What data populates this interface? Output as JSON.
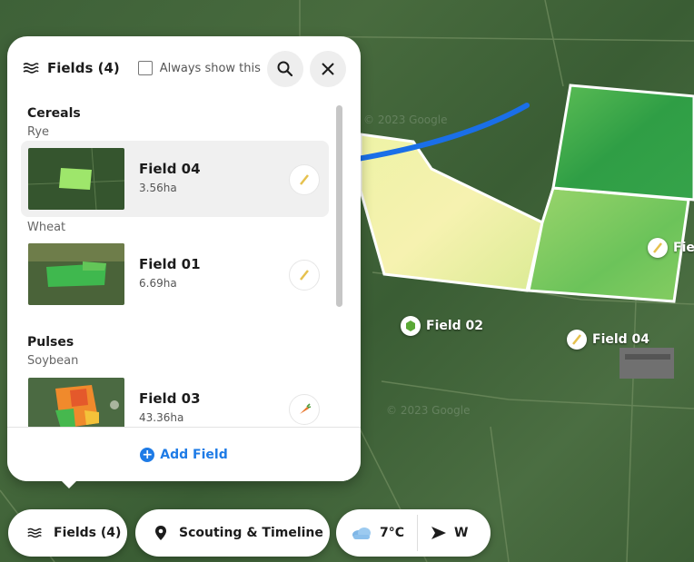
{
  "panel": {
    "title": "Fields (4)",
    "always_show_label": "Always show this",
    "add_field_label": "Add Field",
    "groups": [
      {
        "name": "Cereals",
        "crops": [
          {
            "crop": "Rye",
            "fields": [
              {
                "name": "Field 04",
                "area": "3.56ha",
                "selected": true,
                "crop_icon": "wheat-icon"
              }
            ]
          },
          {
            "crop": "Wheat",
            "fields": [
              {
                "name": "Field 01",
                "area": "6.69ha",
                "selected": false,
                "crop_icon": "wheat-icon"
              }
            ]
          }
        ]
      },
      {
        "name": "Pulses",
        "crops": [
          {
            "crop": "Soybean",
            "fields": [
              {
                "name": "Field 03",
                "area": "43.36ha",
                "selected": false,
                "crop_icon": "carrot-icon"
              }
            ]
          }
        ]
      }
    ]
  },
  "map": {
    "labels": [
      {
        "text": "Field 02",
        "icon": "soy-leaf-icon"
      },
      {
        "text": "Field 04",
        "icon": "wheat-icon"
      },
      {
        "text": "Fie",
        "icon": "wheat-icon"
      }
    ],
    "watermark": "© 2023 Google"
  },
  "toolbar": {
    "fields_label": "Fields (4)",
    "scouting_label": "Scouting & Timeline",
    "temperature": "7°C",
    "wind_direction": "W"
  },
  "colors": {
    "accent": "#1e7be6",
    "arrow": "#1a6fe8"
  }
}
